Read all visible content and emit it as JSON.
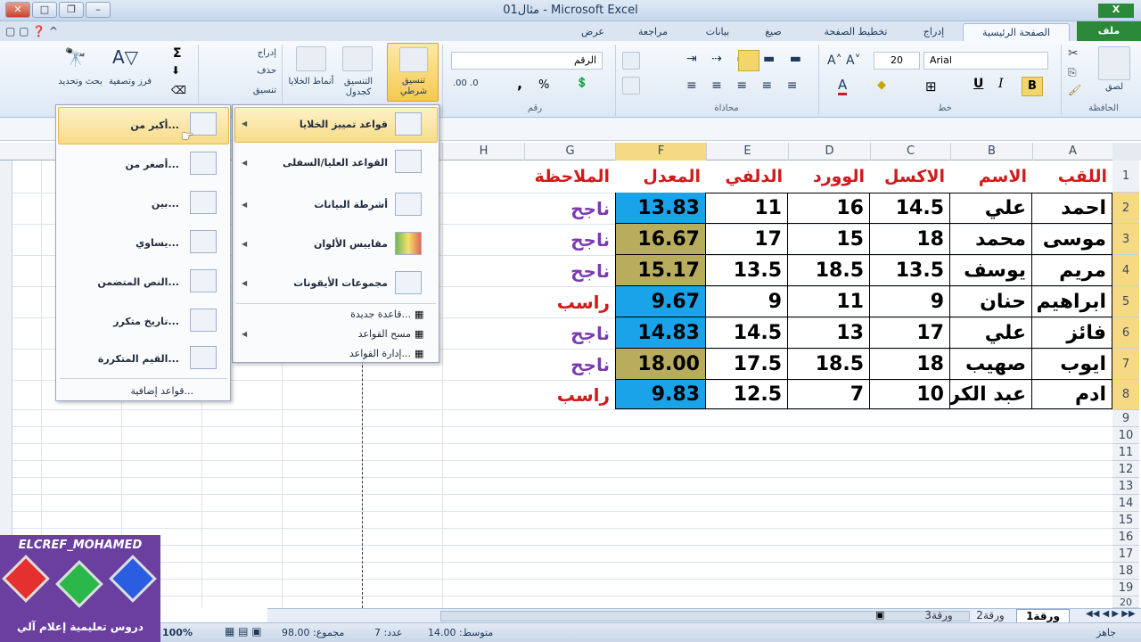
{
  "window": {
    "title": "مثال01 - Microsoft Excel"
  },
  "tabs": [
    "الصفحة الرئيسية",
    "إدراج",
    "تخطيط الصفحة",
    "صيغ",
    "بيانات",
    "مراجعة",
    "عرض"
  ],
  "file_tab": "ملف",
  "ribbon": {
    "groups": {
      "clipboard": "الحافظة",
      "font": "خط",
      "alignment": "محاذاة",
      "number": "رقم",
      "cells_label": ""
    },
    "paste_label": "لصق",
    "font_name": "Arial",
    "font_size": "20",
    "number_format": "الرقم",
    "conditional_formatting": "تنسيق شرطي",
    "format_as_table": "التنسيق كجدول",
    "cell_styles": "أنماط الخلايا",
    "insert": "إدراج",
    "delete": "حذف",
    "format": "تنسيق",
    "sort_filter": "فرز وتصفية",
    "find_select": "بحث وتحديد",
    "sum_icon": "Σ",
    "percent": "%",
    "comma": ","
  },
  "columns": [
    "A",
    "B",
    "C",
    "D",
    "E",
    "F",
    "G",
    "H"
  ],
  "rows": [
    "1",
    "2",
    "3",
    "4",
    "5",
    "6",
    "7",
    "8",
    "9",
    "10",
    "11",
    "12",
    "13",
    "14",
    "15",
    "16",
    "17",
    "18",
    "19",
    "20"
  ],
  "table": {
    "headers": [
      "اللقب",
      "الاسم",
      "الاكسل",
      "الوورد",
      "الدلفي",
      "المعدل",
      "الملاحظة"
    ],
    "data": [
      [
        "احمد",
        "علي",
        "14.5",
        "16",
        "11",
        "13.83",
        "ناجح"
      ],
      [
        "موسى",
        "محمد",
        "18",
        "15",
        "17",
        "16.67",
        "ناجح"
      ],
      [
        "مريم",
        "يوسف",
        "13.5",
        "18.5",
        "13.5",
        "15.17",
        "ناجح"
      ],
      [
        "ابراهيم",
        "حنان",
        "9",
        "11",
        "9",
        "9.67",
        "راسب"
      ],
      [
        "فائز",
        "علي",
        "17",
        "13",
        "14.5",
        "14.83",
        "ناجح"
      ],
      [
        "ايوب",
        "صهيب",
        "18",
        "18.5",
        "17.5",
        "18.00",
        "ناجح"
      ],
      [
        "ادم",
        "عبد الكر",
        "10",
        "7",
        "12.5",
        "9.83",
        "راسب"
      ]
    ]
  },
  "menu_main": {
    "items": [
      "قواعد تمييز الخلايا",
      "القواعد العليا/السفلى",
      "أشرطة البيانات",
      "مقاييس الألوان",
      "مجموعات الأيقونات"
    ],
    "small": [
      "قاعدة جديدة...",
      "مسح القواعد",
      "إدارة القواعد..."
    ]
  },
  "menu_sub": {
    "items": [
      "أكبر من...",
      "أصغر من...",
      "بين...",
      "يساوي...",
      "النص المتضمن...",
      "تاريخ متكرر...",
      "القيم المتكررة..."
    ],
    "more": "قواعد إضافية..."
  },
  "sheets": [
    "ورقة1",
    "ورقة2",
    "ورقة3"
  ],
  "status": {
    "ready": "جاهز",
    "average": "متوسط: 14.00",
    "count": "عدد: 7",
    "sum": "مجموع: 98.00",
    "zoom": "100%"
  },
  "logo": {
    "name": "ELCREF_MOHAMED",
    "caption": "دروس تعليمية إعلام آلي"
  }
}
